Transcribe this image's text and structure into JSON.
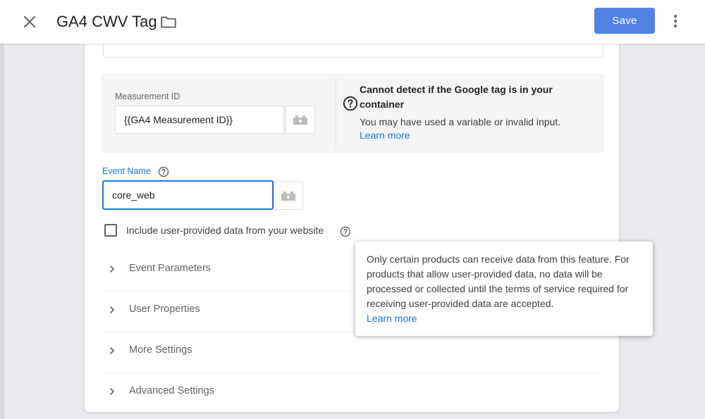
{
  "topbar": {
    "title": "GA4 CWV Tag",
    "save_label": "Save"
  },
  "measurement": {
    "label": "Measurement ID",
    "value": "{{GA4 Measurement ID}}",
    "warning_title": "Cannot detect if the Google tag is in your container",
    "warning_body": "You may have used a variable or invalid input.",
    "learn_more": "Learn more"
  },
  "event_name": {
    "label": "Event Name",
    "value": "core_web"
  },
  "user_data": {
    "label": "Include user-provided data from your website",
    "checked": false
  },
  "sections": [
    {
      "label": "Event Parameters"
    },
    {
      "label": "User Properties"
    },
    {
      "label": "More Settings"
    },
    {
      "label": "Advanced Settings"
    }
  ],
  "tooltip": {
    "text": "Only certain products can receive data from this feature. For products that allow user-provided data, no data will be processed or collected until the terms of service required for receiving user-provided data are accepted.",
    "link": "Learn more"
  },
  "colors": {
    "primary": "#1a73e8",
    "save_button": "#5282e4",
    "background": "#e8eaed"
  },
  "icons": [
    "close-icon",
    "folder-icon",
    "more-vert-icon",
    "help-icon",
    "variable-icon",
    "chevron-right-icon"
  ]
}
